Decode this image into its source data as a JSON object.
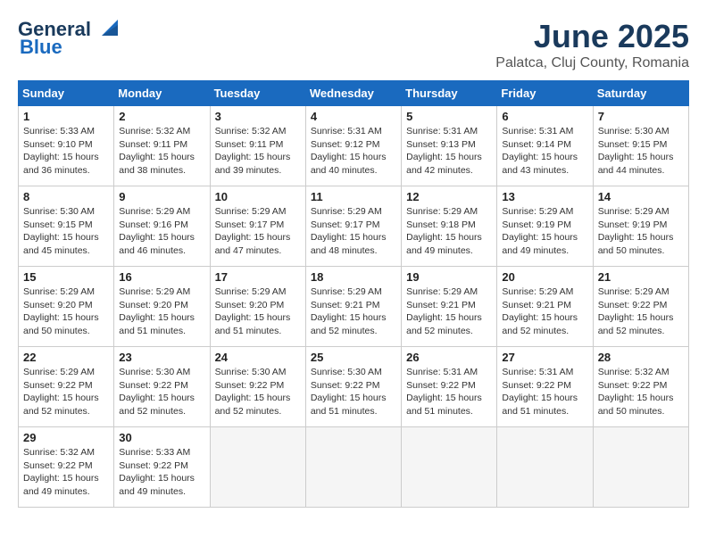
{
  "header": {
    "logo_line1": "General",
    "logo_line2": "Blue",
    "title": "June 2025",
    "subtitle": "Palatca, Cluj County, Romania"
  },
  "calendar": {
    "days_of_week": [
      "Sunday",
      "Monday",
      "Tuesday",
      "Wednesday",
      "Thursday",
      "Friday",
      "Saturday"
    ],
    "weeks": [
      [
        null,
        {
          "day": 2,
          "sunrise": "5:32 AM",
          "sunset": "9:11 PM",
          "daylight": "15 hours and 38 minutes."
        },
        {
          "day": 3,
          "sunrise": "5:32 AM",
          "sunset": "9:11 PM",
          "daylight": "15 hours and 39 minutes."
        },
        {
          "day": 4,
          "sunrise": "5:31 AM",
          "sunset": "9:12 PM",
          "daylight": "15 hours and 40 minutes."
        },
        {
          "day": 5,
          "sunrise": "5:31 AM",
          "sunset": "9:13 PM",
          "daylight": "15 hours and 42 minutes."
        },
        {
          "day": 6,
          "sunrise": "5:31 AM",
          "sunset": "9:14 PM",
          "daylight": "15 hours and 43 minutes."
        },
        {
          "day": 7,
          "sunrise": "5:30 AM",
          "sunset": "9:15 PM",
          "daylight": "15 hours and 44 minutes."
        }
      ],
      [
        {
          "day": 1,
          "sunrise": "5:33 AM",
          "sunset": "9:10 PM",
          "daylight": "15 hours and 36 minutes."
        },
        {
          "day": 2,
          "sunrise": "5:32 AM",
          "sunset": "9:11 PM",
          "daylight": "15 hours and 38 minutes."
        },
        {
          "day": 3,
          "sunrise": "5:32 AM",
          "sunset": "9:11 PM",
          "daylight": "15 hours and 39 minutes."
        },
        {
          "day": 4,
          "sunrise": "5:31 AM",
          "sunset": "9:12 PM",
          "daylight": "15 hours and 40 minutes."
        },
        {
          "day": 5,
          "sunrise": "5:31 AM",
          "sunset": "9:13 PM",
          "daylight": "15 hours and 42 minutes."
        },
        {
          "day": 6,
          "sunrise": "5:31 AM",
          "sunset": "9:14 PM",
          "daylight": "15 hours and 43 minutes."
        },
        {
          "day": 7,
          "sunrise": "5:30 AM",
          "sunset": "9:15 PM",
          "daylight": "15 hours and 44 minutes."
        }
      ],
      [
        {
          "day": 8,
          "sunrise": "5:30 AM",
          "sunset": "9:15 PM",
          "daylight": "15 hours and 45 minutes."
        },
        {
          "day": 9,
          "sunrise": "5:29 AM",
          "sunset": "9:16 PM",
          "daylight": "15 hours and 46 minutes."
        },
        {
          "day": 10,
          "sunrise": "5:29 AM",
          "sunset": "9:17 PM",
          "daylight": "15 hours and 47 minutes."
        },
        {
          "day": 11,
          "sunrise": "5:29 AM",
          "sunset": "9:17 PM",
          "daylight": "15 hours and 48 minutes."
        },
        {
          "day": 12,
          "sunrise": "5:29 AM",
          "sunset": "9:18 PM",
          "daylight": "15 hours and 49 minutes."
        },
        {
          "day": 13,
          "sunrise": "5:29 AM",
          "sunset": "9:19 PM",
          "daylight": "15 hours and 49 minutes."
        },
        {
          "day": 14,
          "sunrise": "5:29 AM",
          "sunset": "9:19 PM",
          "daylight": "15 hours and 50 minutes."
        }
      ],
      [
        {
          "day": 15,
          "sunrise": "5:29 AM",
          "sunset": "9:20 PM",
          "daylight": "15 hours and 50 minutes."
        },
        {
          "day": 16,
          "sunrise": "5:29 AM",
          "sunset": "9:20 PM",
          "daylight": "15 hours and 51 minutes."
        },
        {
          "day": 17,
          "sunrise": "5:29 AM",
          "sunset": "9:20 PM",
          "daylight": "15 hours and 51 minutes."
        },
        {
          "day": 18,
          "sunrise": "5:29 AM",
          "sunset": "9:21 PM",
          "daylight": "15 hours and 52 minutes."
        },
        {
          "day": 19,
          "sunrise": "5:29 AM",
          "sunset": "9:21 PM",
          "daylight": "15 hours and 52 minutes."
        },
        {
          "day": 20,
          "sunrise": "5:29 AM",
          "sunset": "9:21 PM",
          "daylight": "15 hours and 52 minutes."
        },
        {
          "day": 21,
          "sunrise": "5:29 AM",
          "sunset": "9:22 PM",
          "daylight": "15 hours and 52 minutes."
        }
      ],
      [
        {
          "day": 22,
          "sunrise": "5:29 AM",
          "sunset": "9:22 PM",
          "daylight": "15 hours and 52 minutes."
        },
        {
          "day": 23,
          "sunrise": "5:30 AM",
          "sunset": "9:22 PM",
          "daylight": "15 hours and 52 minutes."
        },
        {
          "day": 24,
          "sunrise": "5:30 AM",
          "sunset": "9:22 PM",
          "daylight": "15 hours and 52 minutes."
        },
        {
          "day": 25,
          "sunrise": "5:30 AM",
          "sunset": "9:22 PM",
          "daylight": "15 hours and 51 minutes."
        },
        {
          "day": 26,
          "sunrise": "5:31 AM",
          "sunset": "9:22 PM",
          "daylight": "15 hours and 51 minutes."
        },
        {
          "day": 27,
          "sunrise": "5:31 AM",
          "sunset": "9:22 PM",
          "daylight": "15 hours and 51 minutes."
        },
        {
          "day": 28,
          "sunrise": "5:32 AM",
          "sunset": "9:22 PM",
          "daylight": "15 hours and 50 minutes."
        }
      ],
      [
        {
          "day": 29,
          "sunrise": "5:32 AM",
          "sunset": "9:22 PM",
          "daylight": "15 hours and 49 minutes."
        },
        {
          "day": 30,
          "sunrise": "5:33 AM",
          "sunset": "9:22 PM",
          "daylight": "15 hours and 49 minutes."
        },
        null,
        null,
        null,
        null,
        null
      ]
    ]
  }
}
